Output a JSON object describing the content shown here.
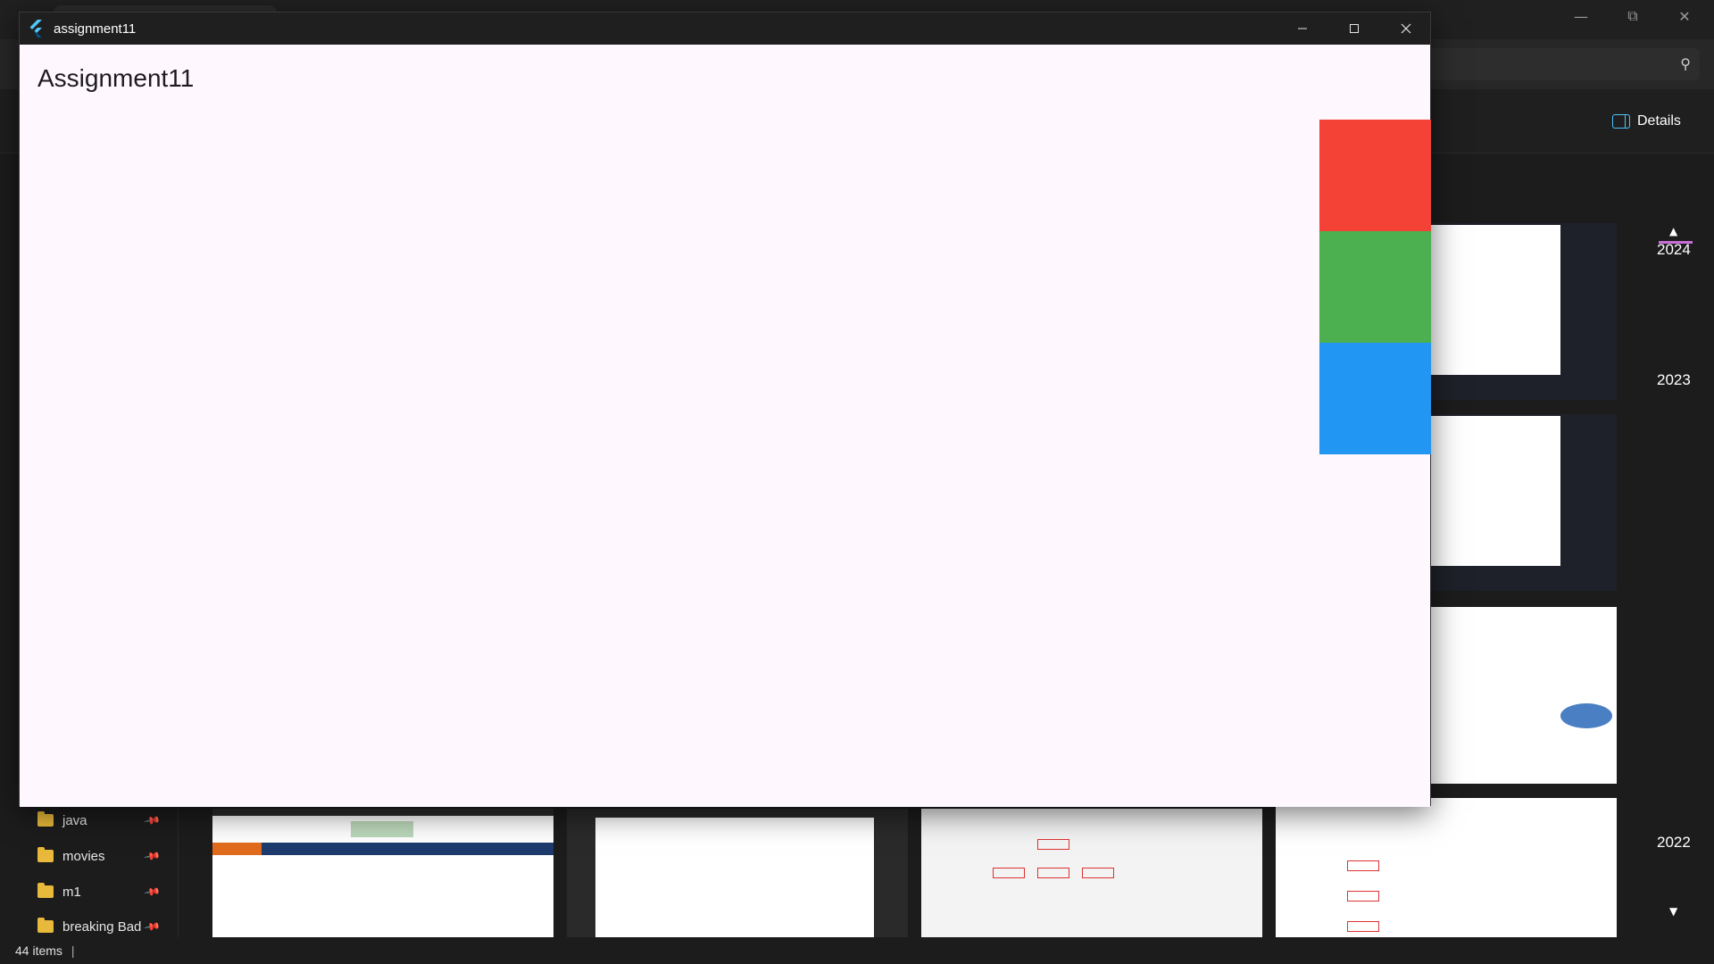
{
  "explorer": {
    "details_label": "Details",
    "sidebar_items": [
      {
        "label": "java"
      },
      {
        "label": "movies"
      },
      {
        "label": "m1"
      },
      {
        "label": "breaking Bad"
      }
    ],
    "timeline_years": [
      "2024",
      "2023",
      "2022"
    ],
    "status_text": "44 items"
  },
  "app": {
    "window_title": "assignment11",
    "heading": "Assignment11",
    "boxes": [
      {
        "name": "red",
        "color": "#f44336"
      },
      {
        "name": "green",
        "color": "#4caf50"
      },
      {
        "name": "blue",
        "color": "#2196f3"
      }
    ]
  }
}
